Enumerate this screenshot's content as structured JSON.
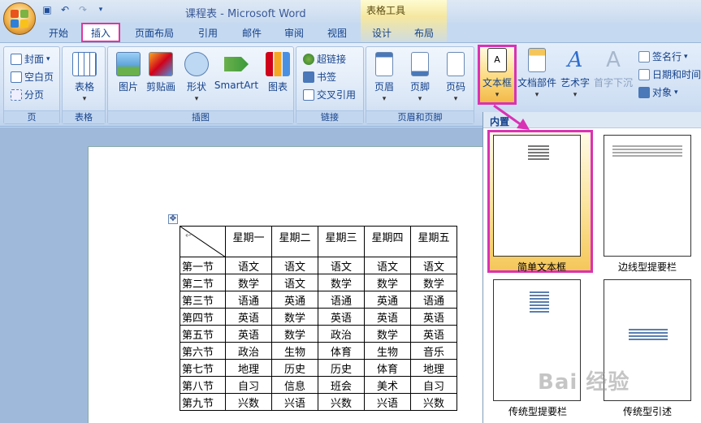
{
  "window": {
    "title": "课程表 - Microsoft Word",
    "context_tab_group": "表格工具"
  },
  "quick_access": {
    "save_icon": "save-icon",
    "undo_icon": "undo-icon",
    "redo_icon": "redo-icon",
    "customize_icon": "qat-dropdown-icon"
  },
  "tabs": [
    {
      "label": "开始"
    },
    {
      "label": "插入",
      "active": true
    },
    {
      "label": "页面布局"
    },
    {
      "label": "引用"
    },
    {
      "label": "邮件"
    },
    {
      "label": "审阅"
    },
    {
      "label": "视图"
    },
    {
      "label": "设计"
    },
    {
      "label": "布局"
    }
  ],
  "ribbon": {
    "pages": {
      "label": "页",
      "cover": "封面",
      "blank": "空白页",
      "break": "分页"
    },
    "tables": {
      "label": "表格",
      "table": "表格"
    },
    "illustrations": {
      "label": "插图",
      "picture": "图片",
      "clipart": "剪贴画",
      "shapes": "形状",
      "smartart": "SmartArt",
      "chart": "图表"
    },
    "links": {
      "label": "链接",
      "hyperlink": "超链接",
      "bookmark": "书签",
      "crossref": "交叉引用"
    },
    "headerfooter": {
      "label": "页眉和页脚",
      "header": "页眉",
      "footer": "页脚",
      "pagenum": "页码"
    },
    "text": {
      "textbox": "文本框",
      "quickparts": "文档部件",
      "wordart": "艺术字",
      "dropcap": "首字下沉",
      "signature": "签名行",
      "datetime": "日期和时间",
      "object": "对象"
    }
  },
  "gallery": {
    "header": "内置",
    "items": [
      {
        "label": "简单文本框",
        "selected": true
      },
      {
        "label": "边线型提要栏"
      },
      {
        "label": "传统型提要栏"
      },
      {
        "label": "传统型引述"
      }
    ]
  },
  "schedule": {
    "days": [
      "星期一",
      "星期二",
      "星期三",
      "星期四",
      "星期五"
    ],
    "rows": [
      {
        "period": "第一节",
        "cells": [
          "语文",
          "语文",
          "语文",
          "语文",
          "语文"
        ]
      },
      {
        "period": "第二节",
        "cells": [
          "数学",
          "语文",
          "数学",
          "数学",
          "数学"
        ]
      },
      {
        "period": "第三节",
        "cells": [
          "语通",
          "英通",
          "语通",
          "英通",
          "语通"
        ]
      },
      {
        "period": "第四节",
        "cells": [
          "英语",
          "数学",
          "英语",
          "英语",
          "英语"
        ]
      },
      {
        "period": "第五节",
        "cells": [
          "英语",
          "数学",
          "政治",
          "数学",
          "英语"
        ]
      },
      {
        "period": "第六节",
        "cells": [
          "政治",
          "生物",
          "体育",
          "生物",
          "音乐"
        ]
      },
      {
        "period": "第七节",
        "cells": [
          "地理",
          "历史",
          "历史",
          "体育",
          "地理"
        ]
      },
      {
        "period": "第八节",
        "cells": [
          "自习",
          "信息",
          "班会",
          "美术",
          "自习"
        ]
      },
      {
        "period": "第九节",
        "cells": [
          "兴数",
          "兴语",
          "兴数",
          "兴语",
          "兴数"
        ]
      }
    ]
  },
  "watermark": "Bai 经验",
  "colors": {
    "highlight": "#d932b4",
    "accent": "#15428b"
  }
}
